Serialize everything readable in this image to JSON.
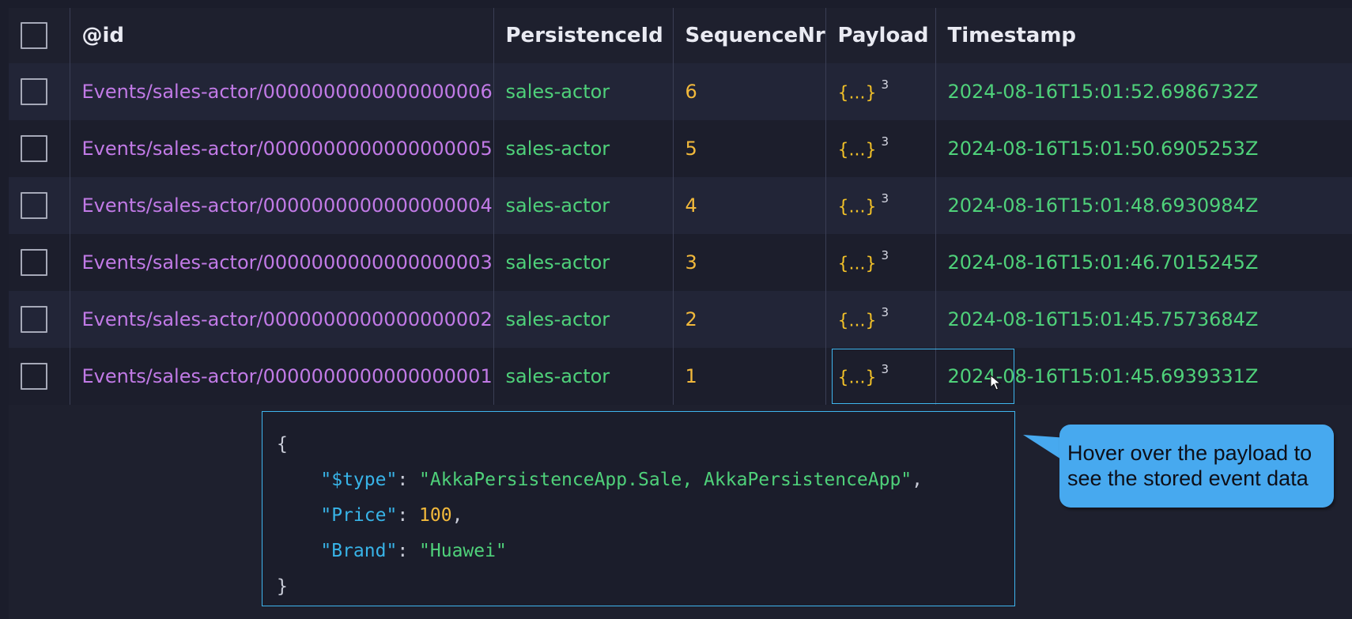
{
  "columns": [
    "@id",
    "PersistenceId",
    "SequenceNr",
    "Payload",
    "Timestamp"
  ],
  "rows": [
    {
      "id": "Events/sales-actor/0000000000000000006",
      "persistence_id": "sales-actor",
      "sequence_nr": "6",
      "payload": "{...}",
      "payload_count": "3",
      "timestamp": "2024-08-16T15:01:52.6986732Z"
    },
    {
      "id": "Events/sales-actor/0000000000000000005",
      "persistence_id": "sales-actor",
      "sequence_nr": "5",
      "payload": "{...}",
      "payload_count": "3",
      "timestamp": "2024-08-16T15:01:50.6905253Z"
    },
    {
      "id": "Events/sales-actor/0000000000000000004",
      "persistence_id": "sales-actor",
      "sequence_nr": "4",
      "payload": "{...}",
      "payload_count": "3",
      "timestamp": "2024-08-16T15:01:48.6930984Z"
    },
    {
      "id": "Events/sales-actor/0000000000000000003",
      "persistence_id": "sales-actor",
      "sequence_nr": "3",
      "payload": "{...}",
      "payload_count": "3",
      "timestamp": "2024-08-16T15:01:46.7015245Z"
    },
    {
      "id": "Events/sales-actor/0000000000000000002",
      "persistence_id": "sales-actor",
      "sequence_nr": "2",
      "payload": "{...}",
      "payload_count": "3",
      "timestamp": "2024-08-16T15:01:45.7573684Z"
    },
    {
      "id": "Events/sales-actor/0000000000000000001",
      "persistence_id": "sales-actor",
      "sequence_nr": "1",
      "payload": "{...}",
      "payload_count": "3",
      "timestamp": "2024-08-16T15:01:45.6939331Z"
    }
  ],
  "payload_tooltip": {
    "open_brace": "{",
    "close_brace": "}",
    "fields": [
      {
        "key": "\"$type\"",
        "value": "\"AkkaPersistenceApp.Sale, AkkaPersistenceApp\"",
        "value_kind": "string",
        "trailing": ","
      },
      {
        "key": "\"Price\"",
        "value": "100",
        "value_kind": "number",
        "trailing": ","
      },
      {
        "key": "\"Brand\"",
        "value": "\"Huawei\"",
        "value_kind": "string",
        "trailing": ""
      }
    ]
  },
  "callout": {
    "line1": "Hover over the payload to",
    "line2": "see the stored event data"
  },
  "colors": {
    "id": "#c17ae6",
    "persistence_id": "#4fd17a",
    "sequence_nr": "#f2b93b",
    "payload": "#f2c128",
    "timestamp": "#4fd17a",
    "accent": "#3fb5ee",
    "callout": "#47a9ef"
  }
}
